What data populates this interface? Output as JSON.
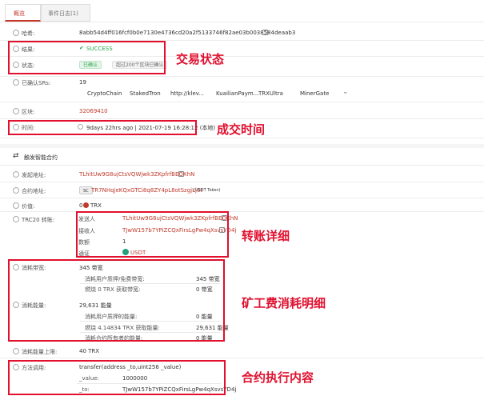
{
  "tabs": [
    "概览",
    "事件日志(1)"
  ],
  "hash": {
    "label": "哈希:",
    "value": "8abb54d4ff016fcf0b0e7130e4736cd20a2f5133746f82ae03b0038584deaab3"
  },
  "result": {
    "label": "结果:",
    "value": "SUCCESS"
  },
  "status": {
    "label": "状态:",
    "confirmed": "已确认",
    "note": "超过200个区块已确认"
  },
  "srs": {
    "label": "已确认SRs:",
    "count": "19",
    "names": [
      "CryptoChain",
      "StakedTron",
      "http://klev...",
      "KuailianPaym...",
      "TRXUltra",
      "MinerGate"
    ]
  },
  "block": {
    "label": "区块:",
    "value": "32069410"
  },
  "time": {
    "label": "时间:",
    "value": "9days 22hrs ago | 2021-07-19 16:28:12 (本地)"
  },
  "section_title": "触发智能合约",
  "from": {
    "label": "发起地址:",
    "value": "TLhitUw9G8ujCtsVQWjwk3ZKpfrfBEQXhN"
  },
  "contract": {
    "label": "合约地址:",
    "badge": "SC",
    "value": "TR7NHqjeKQxGTCi8q8ZY4pL8otSzgjLj6t",
    "token": "(USDT Token)"
  },
  "value": {
    "label": "价值:",
    "amount": "0",
    "unit": "TRX"
  },
  "trc20": {
    "label": "TRC20 转账:",
    "sender_label": "发送人",
    "sender": "TLhitUw9G8ujCtsVQWjwk3ZKpfrfBEQXhN",
    "receiver_label": "接收人",
    "receiver": "TJwW157b7YPiZCQxFirsLgPw4qXsvsYD4j",
    "amount_label": "数额",
    "amount": "1",
    "token_label": "通证",
    "token": "USDT"
  },
  "bandwidth": {
    "label": "消耗带宽:",
    "value": "345 带宽",
    "rows": [
      {
        "k": "消耗用户质押/免费带宽:",
        "v": "345 带宽"
      },
      {
        "k": "燃烧 0 TRX 获取带宽:",
        "v": "0 带宽"
      }
    ]
  },
  "energy": {
    "label": "消耗能量:",
    "value": "29,631 能量",
    "rows": [
      {
        "k": "消耗用户质押的能量:",
        "v": "0 能量"
      },
      {
        "k": "燃烧 4.14834 TRX 获取能量:",
        "v": "29,631 能量"
      },
      {
        "k": "消耗合约所有者的能量:",
        "v": "0 能量"
      }
    ]
  },
  "fee_limit": {
    "label": "消耗能量上限:",
    "value": "40 TRX"
  },
  "method": {
    "label": "方法调用:",
    "sig": "transfer(address _to,uint256 _value)",
    "p1k": "_value:",
    "p1v": "1000000",
    "p2k": "_to:",
    "p2v": "TJwW157b7YPiZCQxFirsLgPw4qXsvsYD4j"
  },
  "annotations": [
    "交易状态",
    "成交时间",
    "转账详细",
    "矿工费消耗明细",
    "合约执行内容"
  ]
}
